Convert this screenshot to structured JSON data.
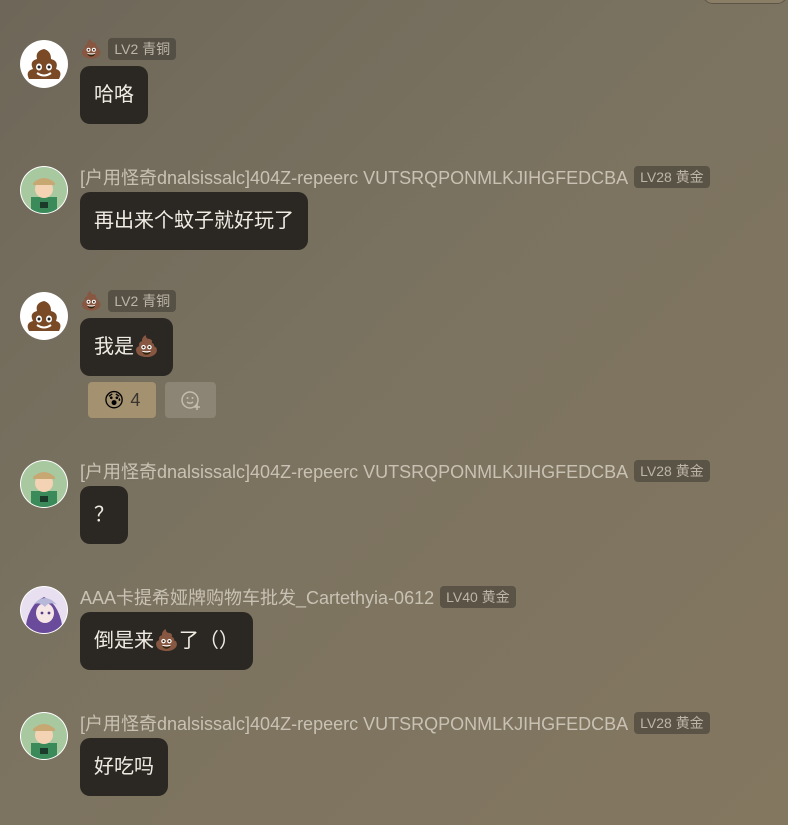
{
  "messages": [
    {
      "name": "💩",
      "level": "LV2 青铜",
      "text": "哈咯",
      "avatar": "poop"
    },
    {
      "name": "[户用怪奇dnalsissalc]404Z-repeerc VUTSRQPONMLKJIHGFEDCBA",
      "level": "LV28 黄金",
      "text": "再出来个蚊子就好玩了",
      "avatar": "boy"
    },
    {
      "name": "💩",
      "level": "LV2 青铜",
      "text": "我是💩",
      "avatar": "poop",
      "reactions": [
        {
          "emoji": "😰",
          "count": "4"
        }
      ]
    },
    {
      "name": "[户用怪奇dnalsissalc]404Z-repeerc VUTSRQPONMLKJIHGFEDCBA",
      "level": "LV28 黄金",
      "text": "？",
      "avatar": "boy"
    },
    {
      "name": "AAA卡提希娅牌购物车批发_Cartethyia-0612",
      "level": "LV40 黄金",
      "text": "倒是来💩了（）",
      "avatar": "anime"
    },
    {
      "name": "[户用怪奇dnalsissalc]404Z-repeerc VUTSRQPONMLKJIHGFEDCBA",
      "level": "LV28 黄金",
      "text": "好吃吗",
      "avatar": "boy"
    }
  ]
}
